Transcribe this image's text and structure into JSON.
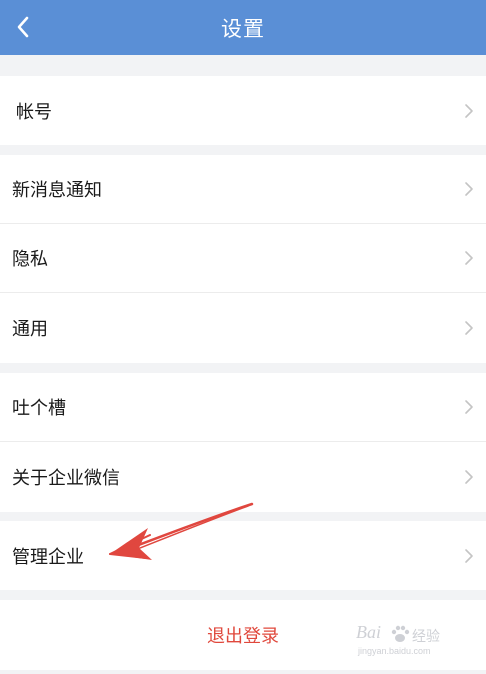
{
  "navbar": {
    "title": "设置"
  },
  "groups": [
    [
      {
        "label": "帐号"
      }
    ],
    [
      {
        "label": "新消息通知"
      },
      {
        "label": "隐私"
      },
      {
        "label": "通用"
      }
    ],
    [
      {
        "label": "吐个槽"
      },
      {
        "label": "关于企业微信"
      }
    ],
    [
      {
        "label": "管理企业"
      }
    ]
  ],
  "logout": {
    "label": "退出登录"
  },
  "watermark": {
    "brand": "Bai",
    "brand_suffix": "经验",
    "url": "jingyan.baidu.com"
  },
  "colors": {
    "navbar": "#5a8fd6",
    "logout_text": "#e0483c",
    "annotation_arrow": "#e0473f",
    "background": "#f2f3f5"
  }
}
